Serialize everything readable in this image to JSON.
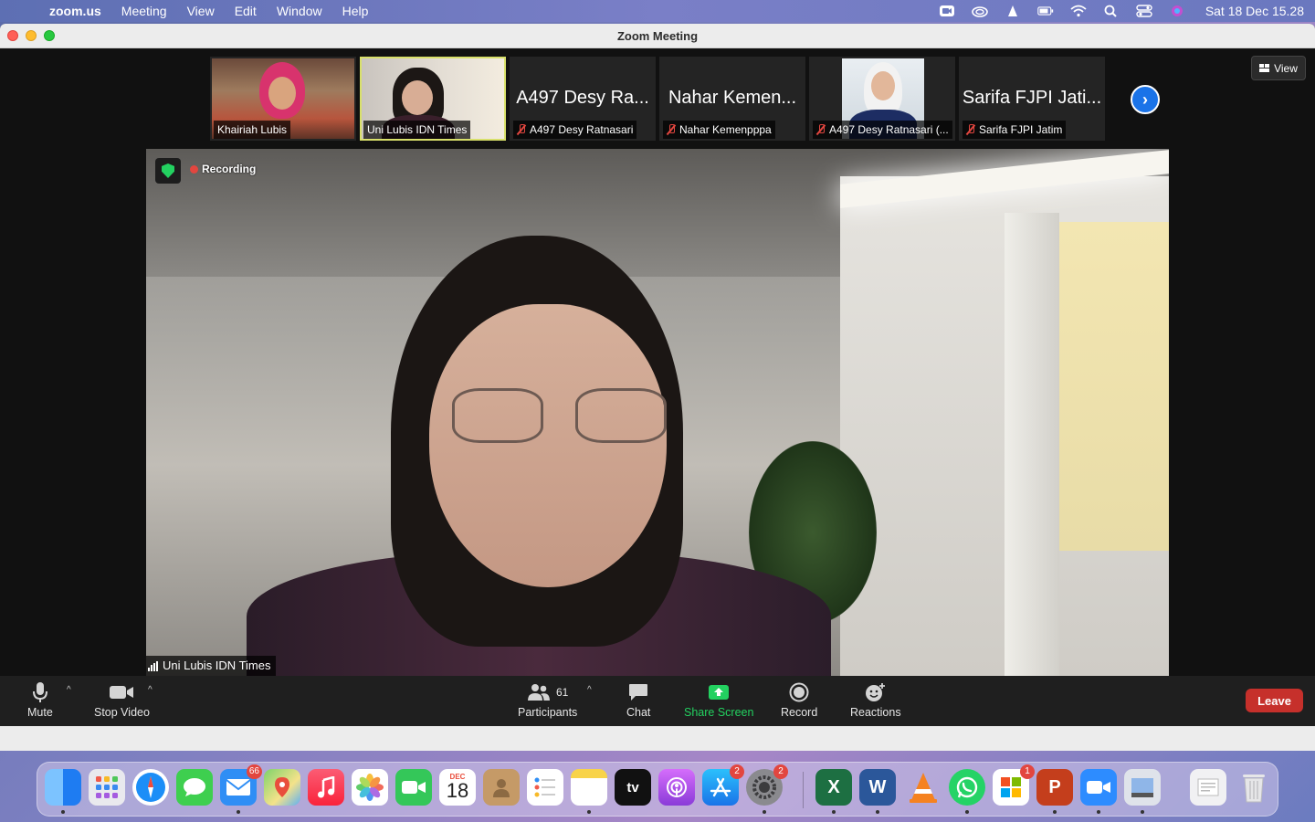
{
  "menubar": {
    "app_name": "zoom.us",
    "menus": [
      "Meeting",
      "View",
      "Edit",
      "Window",
      "Help"
    ],
    "clock": "Sat 18 Dec  15.28",
    "icons": [
      "zoom-status-icon",
      "creative-cloud-icon",
      "vlc-icon",
      "battery-icon",
      "wifi-icon",
      "spotlight-icon",
      "control-center-icon",
      "siri-icon"
    ]
  },
  "window": {
    "title": "Zoom Meeting"
  },
  "gallery": {
    "tiles": [
      {
        "display_name": "",
        "label": "Khairiah Lubis",
        "muted": false,
        "video": true
      },
      {
        "display_name": "",
        "label": "Uni Lubis IDN Times",
        "muted": false,
        "video": true,
        "active": true
      },
      {
        "display_name": "A497 Desy Ra...",
        "label": "A497 Desy Ratnasari",
        "muted": true,
        "video": false
      },
      {
        "display_name": "Nahar Kemen...",
        "label": "Nahar Kemenpppa",
        "muted": true,
        "video": false
      },
      {
        "display_name": "",
        "label": "A497 Desy Ratnasari (...",
        "muted": true,
        "video": true
      },
      {
        "display_name": "Sarifa FJPI Jati...",
        "label": "Sarifa FJPI Jatim",
        "muted": true,
        "video": false
      }
    ],
    "view_label": "View"
  },
  "main_video": {
    "recording_label": "Recording",
    "speaker_name": "Uni Lubis IDN Times"
  },
  "controls": {
    "mute": "Mute",
    "stop_video": "Stop Video",
    "participants": "Participants",
    "participants_count": "61",
    "chat": "Chat",
    "share_screen": "Share Screen",
    "record": "Record",
    "reactions": "Reactions",
    "leave": "Leave"
  },
  "dock": {
    "calendar_month": "DEC",
    "calendar_day": "18",
    "mail_badge": "66",
    "appstore_badge": "2",
    "settings_badge": "2",
    "office_badge": "1",
    "items": [
      "finder-icon",
      "launchpad-icon",
      "safari-icon",
      "messages-icon",
      "mail-icon",
      "maps-icon",
      "music-icon",
      "photos-icon",
      "facetime-icon",
      "calendar-icon",
      "contacts-icon",
      "reminders-icon",
      "notes-icon",
      "appletv-icon",
      "podcasts-icon",
      "appstore-icon",
      "system-preferences-icon",
      "excel-icon",
      "word-icon",
      "vlc-icon",
      "whatsapp-icon",
      "microsoft-office-icon",
      "powerpoint-icon",
      "zoom-icon",
      "preview-icon",
      "documents-icon",
      "trash-icon"
    ],
    "appletv_label": "tv",
    "excel_label": "X",
    "word_label": "W",
    "powerpoint_label": "P"
  },
  "colors": {
    "leave_button": "#c6302b",
    "share_screen": "#23d160",
    "active_speaker_border": "#d8e06b",
    "next_arrow": "#1a73e8"
  }
}
